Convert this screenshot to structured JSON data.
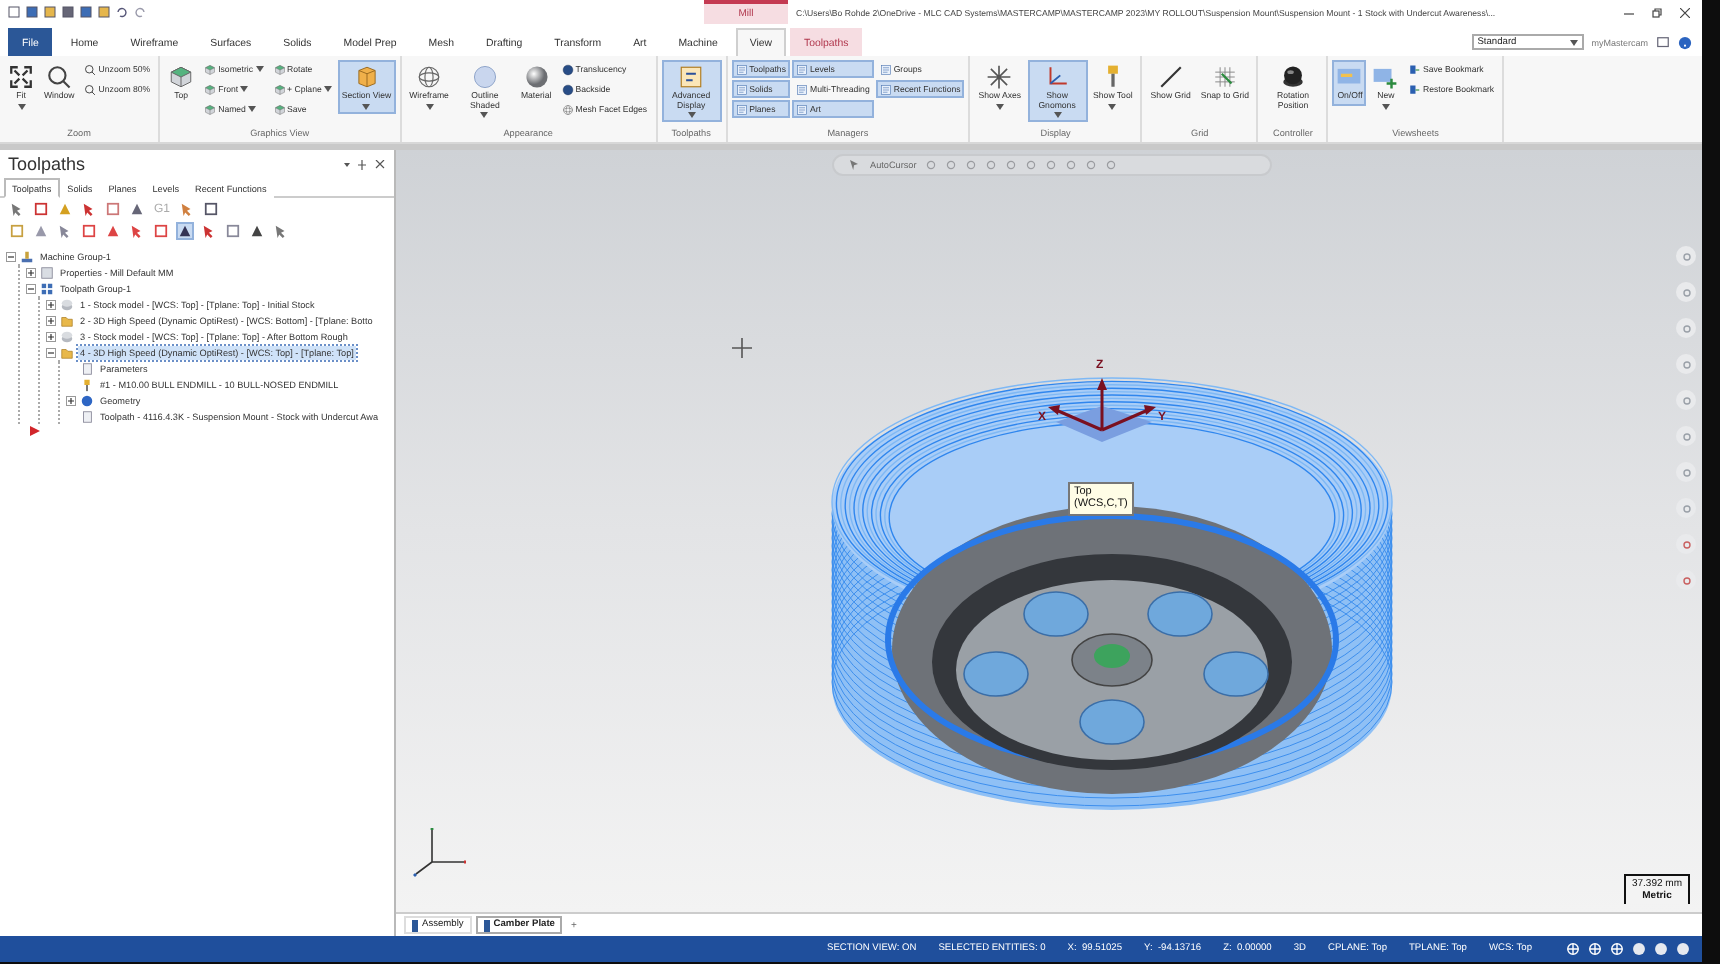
{
  "title_bar": {
    "context": "Mill",
    "path": "C:\\Users\\Bo Rohde 2\\OneDrive - MLC CAD Systems\\MASTERCAMP\\MASTERCAMP 2023\\MY ROLLOUT\\Suspension Mount\\Suspension Mount - 1 Stock with Undercut Awareness\\..."
  },
  "ribbon_tabs": [
    {
      "label": "File",
      "kind": "file",
      "selected": false
    },
    {
      "label": "Home",
      "kind": "tab",
      "selected": false
    },
    {
      "label": "Wireframe",
      "kind": "tab",
      "selected": false
    },
    {
      "label": "Surfaces",
      "kind": "tab",
      "selected": false
    },
    {
      "label": "Solids",
      "kind": "tab",
      "selected": false
    },
    {
      "label": "Model Prep",
      "kind": "tab",
      "selected": false
    },
    {
      "label": "Mesh",
      "kind": "tab",
      "selected": false
    },
    {
      "label": "Drafting",
      "kind": "tab",
      "selected": false
    },
    {
      "label": "Transform",
      "kind": "tab",
      "selected": false
    },
    {
      "label": "Art",
      "kind": "tab",
      "selected": false
    },
    {
      "label": "Machine",
      "kind": "tab",
      "selected": false
    },
    {
      "label": "View",
      "kind": "tab",
      "selected": true
    },
    {
      "label": "Toolpaths",
      "kind": "contextual",
      "selected": false
    }
  ],
  "workspace": {
    "value": "Standard",
    "account": "myMastercam"
  },
  "ribbon_groups": [
    {
      "label": "Zoom",
      "items": [
        {
          "label": "Fit",
          "kind": "large",
          "menu": true,
          "selected": false
        },
        {
          "label": "Window",
          "kind": "large",
          "menu": false,
          "selected": false
        },
        {
          "label": "Unzoom 50%",
          "kind": "small",
          "menu": false,
          "selected": false
        },
        {
          "label": "Unzoom 80%",
          "kind": "small",
          "menu": false,
          "selected": false
        }
      ]
    },
    {
      "label": "Graphics View",
      "items": [
        {
          "label": "Top",
          "kind": "large",
          "menu": false,
          "selected": false
        },
        {
          "label": "Isometric",
          "kind": "small",
          "menu": true,
          "selected": false
        },
        {
          "label": "Front",
          "kind": "small",
          "menu": true,
          "selected": false
        },
        {
          "label": "Named",
          "kind": "small",
          "menu": true,
          "selected": false
        },
        {
          "label": "Rotate",
          "kind": "small",
          "menu": false,
          "selected": false
        },
        {
          "label": "+ Cplane",
          "kind": "small",
          "menu": true,
          "selected": false
        },
        {
          "label": "Save",
          "kind": "small",
          "menu": false,
          "selected": false
        },
        {
          "label": "Section View",
          "kind": "large",
          "menu": true,
          "selected": true
        }
      ]
    },
    {
      "label": "Appearance",
      "items": [
        {
          "label": "Wireframe",
          "kind": "large",
          "menu": true,
          "selected": false
        },
        {
          "label": "Outline Shaded",
          "kind": "large",
          "menu": true,
          "selected": false
        },
        {
          "label": "Material",
          "kind": "large",
          "menu": false,
          "selected": false
        },
        {
          "label": "Translucency",
          "kind": "small",
          "menu": false,
          "selected": false
        },
        {
          "label": "Backside",
          "kind": "small",
          "menu": false,
          "selected": false
        },
        {
          "label": "Mesh Facet Edges",
          "kind": "small",
          "menu": false,
          "selected": false
        }
      ]
    },
    {
      "label": "Toolpaths",
      "items": [
        {
          "label": "Advanced Display",
          "kind": "large",
          "menu": true,
          "selected": true
        }
      ]
    },
    {
      "label": "Managers",
      "items": [
        {
          "label": "Toolpaths",
          "kind": "small",
          "menu": false,
          "selected": true
        },
        {
          "label": "Solids",
          "kind": "small",
          "menu": false,
          "selected": true
        },
        {
          "label": "Planes",
          "kind": "small",
          "menu": false,
          "selected": true
        },
        {
          "label": "Levels",
          "kind": "small",
          "menu": false,
          "selected": true
        },
        {
          "label": "Multi-Threading",
          "kind": "small",
          "menu": false,
          "selected": false
        },
        {
          "label": "Art",
          "kind": "small",
          "menu": false,
          "selected": true
        },
        {
          "label": "Groups",
          "kind": "small",
          "menu": false,
          "selected": false
        },
        {
          "label": "Recent Functions",
          "kind": "small",
          "menu": false,
          "selected": true
        }
      ]
    },
    {
      "label": "Display",
      "items": [
        {
          "label": "Show Axes",
          "kind": "large",
          "menu": true,
          "selected": false
        },
        {
          "label": "Show Gnomons",
          "kind": "large",
          "menu": true,
          "selected": true
        },
        {
          "label": "Show Tool",
          "kind": "large",
          "menu": true,
          "selected": false
        }
      ]
    },
    {
      "label": "Grid",
      "items": [
        {
          "label": "Show Grid",
          "kind": "large",
          "menu": false,
          "selected": false
        },
        {
          "label": "Snap to Grid",
          "kind": "large",
          "menu": false,
          "selected": false
        }
      ]
    },
    {
      "label": "Controller",
      "items": [
        {
          "label": "Rotation Position",
          "kind": "large",
          "menu": false,
          "selected": false
        }
      ]
    },
    {
      "label": "Viewsheets",
      "items": [
        {
          "label": "On/Off",
          "kind": "large",
          "menu": false,
          "selected": true
        },
        {
          "label": "New",
          "kind": "large",
          "menu": true,
          "selected": false
        },
        {
          "label": "Save Bookmark",
          "kind": "small",
          "menu": false,
          "selected": false
        },
        {
          "label": "Restore Bookmark",
          "kind": "small",
          "menu": false,
          "selected": false
        }
      ]
    }
  ],
  "panel": {
    "title": "Toolpaths",
    "tabs": [
      {
        "label": "Toolpaths",
        "selected": true
      },
      {
        "label": "Solids",
        "selected": false
      },
      {
        "label": "Planes",
        "selected": false
      },
      {
        "label": "Levels",
        "selected": false
      },
      {
        "label": "Recent Functions",
        "selected": false
      }
    ],
    "toolbar_text": "G1",
    "tree": [
      {
        "label": "Machine Group-1",
        "kind": "machine",
        "expanded": true,
        "selected": false,
        "children": [
          {
            "label": "Properties - Mill Default MM",
            "kind": "properties",
            "expanded": false,
            "selected": false
          },
          {
            "label": "Toolpath Group-1",
            "kind": "group",
            "expanded": true,
            "selected": false,
            "children": [
              {
                "label": "1 - Stock model - [WCS: Top] - [Tplane: Top] - Initial Stock",
                "kind": "stock",
                "expanded": false,
                "selected": false
              },
              {
                "label": "2 - 3D High Speed (Dynamic OptiRest) - [WCS: Bottom] - [Tplane: Botto",
                "kind": "operation",
                "expanded": false,
                "selected": false
              },
              {
                "label": "3 - Stock model - [WCS: Top] - [Tplane: Top] - After Bottom Rough",
                "kind": "stock",
                "expanded": false,
                "selected": false
              },
              {
                "label": "4 - 3D High Speed (Dynamic OptiRest) - [WCS: Top] - [Tplane: Top]",
                "kind": "operation",
                "expanded": true,
                "selected": true,
                "children": [
                  {
                    "label": "Parameters",
                    "kind": "parameters"
                  },
                  {
                    "label": "#1 - M10.00 BULL ENDMILL - 10 BULL-NOSED ENDMILL",
                    "kind": "tool"
                  },
                  {
                    "label": "Geometry",
                    "kind": "geometry",
                    "expanded": false,
                    "selected": false
                  },
                  {
                    "label": "Toolpath - 4116.4.3K - Suspension Mount - Stock with Undercut Awa",
                    "kind": "toolpath"
                  }
                ]
              }
            ]
          }
        ]
      }
    ]
  },
  "viewport": {
    "autocursor": "AutoCursor",
    "gnomon_axes": [
      "X",
      "Y",
      "Z"
    ],
    "tooltip": [
      "Top",
      "(WCS,C,T)"
    ],
    "scale": {
      "value": "37.392 mm",
      "units": "Metric"
    }
  },
  "sheet_tabs": [
    {
      "label": "Assembly",
      "selected": false
    },
    {
      "label": "Camber Plate",
      "selected": true
    }
  ],
  "sheet_add": "+",
  "status_bar": [
    "SECTION VIEW: ON",
    "SELECTED ENTITIES: 0",
    "X:  99.51025",
    "Y:  -94.13716",
    "Z:  0.00000",
    "3D",
    "CPLANE: Top",
    "TPLANE: Top",
    "WCS: Top"
  ]
}
